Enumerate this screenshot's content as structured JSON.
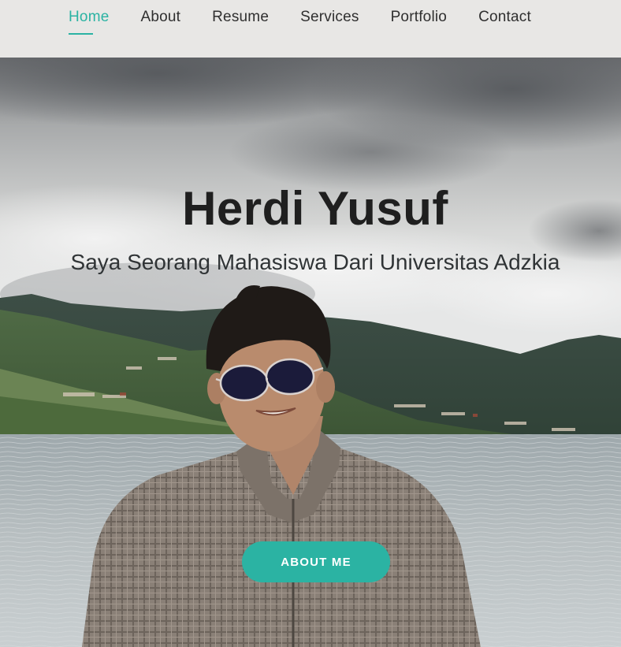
{
  "nav": {
    "items": [
      {
        "label": "Home",
        "active": true
      },
      {
        "label": "About",
        "active": false
      },
      {
        "label": "Resume",
        "active": false
      },
      {
        "label": "Services",
        "active": false
      },
      {
        "label": "Portfolio",
        "active": false
      },
      {
        "label": "Contact",
        "active": false
      }
    ]
  },
  "hero": {
    "title": "Herdi Yusuf",
    "subtitle": "Saya Seorang Mahasiswa Dari Universitas Adzkia",
    "button_label": "ABOUT ME"
  },
  "colors": {
    "accent": "#2bb3a3",
    "nav_background": "#e8e7e5",
    "nav_text": "#2f2f2f",
    "title_text": "#1f1f1f"
  }
}
